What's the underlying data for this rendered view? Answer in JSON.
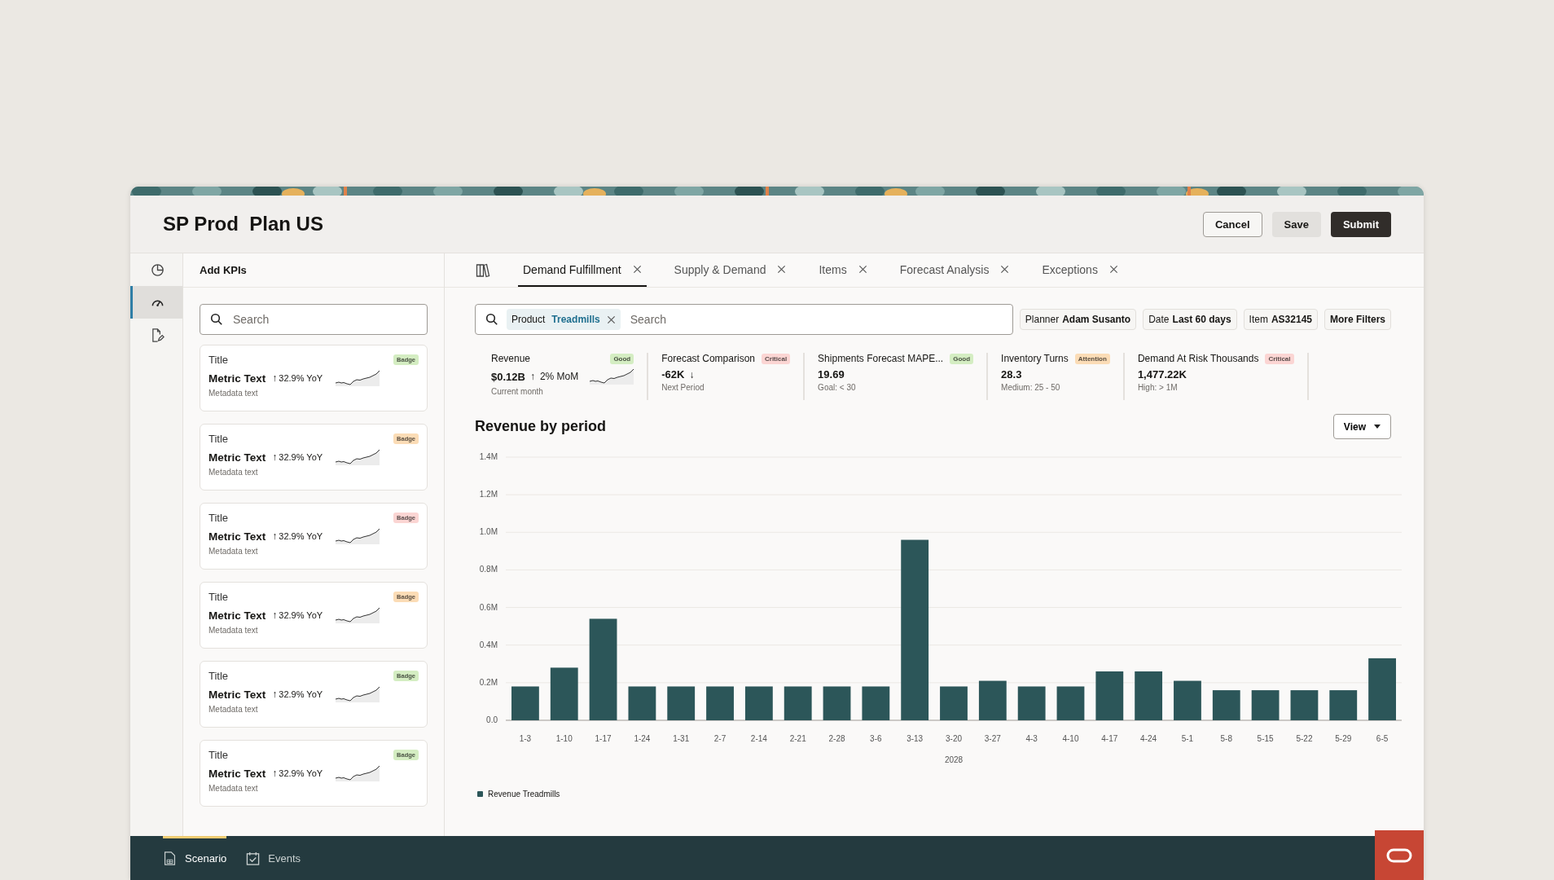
{
  "header": {
    "title": "SP Prod  Plan US",
    "buttons": [
      {
        "label": "Cancel",
        "kind": "outline"
      },
      {
        "label": "Save",
        "kind": "secondary"
      },
      {
        "label": "Submit",
        "kind": "primary"
      }
    ]
  },
  "rail": [
    {
      "selected": false
    },
    {
      "selected": true
    },
    {
      "selected": false
    }
  ],
  "kpi_panel": {
    "title": "Add KPIs",
    "search": {
      "placeholder": "Search"
    },
    "cards": [
      {
        "title": "Title",
        "metric": "Metric Text",
        "arrow": "↑",
        "change": "32.9% YoY",
        "meta": "Metadata text",
        "badge": "Badge",
        "color": "#d4edc2"
      },
      {
        "title": "Title",
        "metric": "Metric Text",
        "arrow": "↑",
        "change": "32.9% YoY",
        "meta": "Metadata text",
        "badge": "Badge",
        "color": "#fbdcb6"
      },
      {
        "title": "Title",
        "metric": "Metric Text",
        "arrow": "↑",
        "change": "32.9% YoY",
        "meta": "Metadata text",
        "badge": "Badge",
        "color": "#fbd5d3"
      },
      {
        "title": "Title",
        "metric": "Metric Text",
        "arrow": "↑",
        "change": "32.9% YoY",
        "meta": "Metadata text",
        "badge": "Badge",
        "color": "#fbdcb6"
      },
      {
        "title": "Title",
        "metric": "Metric Text",
        "arrow": "↑",
        "change": "32.9% YoY",
        "meta": "Metadata text",
        "badge": "Badge",
        "color": "#d4edc2"
      },
      {
        "title": "Title",
        "metric": "Metric Text",
        "arrow": "↑",
        "change": "32.9% YoY",
        "meta": "Metadata text",
        "badge": "Badge",
        "color": "#d4edc2"
      }
    ]
  },
  "tabs": [
    {
      "label": "Demand Fulfillment",
      "selected": true
    },
    {
      "label": "Supply & Demand",
      "selected": false
    },
    {
      "label": "Items",
      "selected": false
    },
    {
      "label": "Forecast Analysis",
      "selected": false
    },
    {
      "label": "Exceptions",
      "selected": false
    }
  ],
  "filter_bar": {
    "search_chip": {
      "label": "Product",
      "value": "Treadmills"
    },
    "search": {
      "placeholder": "Search"
    },
    "chips": [
      {
        "label": "Planner",
        "value": "Adam Susanto"
      },
      {
        "label": "Date",
        "value": "Last 60 days"
      },
      {
        "label": "Item",
        "value": "AS32145"
      }
    ],
    "more_button": "More Filters"
  },
  "kpis": [
    {
      "label": "Revenue",
      "badge": "Good",
      "color": "#d4edc2",
      "value": "$0.12B",
      "arrow": "↑",
      "change": "2% MoM",
      "sparkline": true,
      "meta": "Current month"
    },
    {
      "label": "Forecast Comparison",
      "badge": "Critical",
      "color": "#fbd5d3",
      "value": "-62K",
      "arrow": "↓",
      "sparkline": false,
      "meta": "Next Period"
    },
    {
      "label": "Shipments Forecast MAPE...",
      "badge": "Good",
      "color": "#d4edc2",
      "value": "19.69",
      "sparkline": false,
      "meta": "Goal: < 30"
    },
    {
      "label": "Inventory Turns",
      "badge": "Attention",
      "color": "#fbdcb6",
      "value": "28.3",
      "sparkline": false,
      "meta": "Medium: 25 - 50"
    },
    {
      "label": "Demand At Risk Thousands",
      "badge": "Critical",
      "color": "#fbd5d3",
      "value": "1,477.22K",
      "sparkline": false,
      "meta": "High: > 1M"
    }
  ],
  "chart_panel": {
    "view_button": "View",
    "chart_data": {
      "type": "bar",
      "title": "Revenue by period",
      "xlabel": "2028",
      "categories": [
        "1-3",
        "1-10",
        "1-17",
        "1-24",
        "1-31",
        "2-7",
        "2-14",
        "2-21",
        "2-28",
        "3-6",
        "3-13",
        "3-20",
        "3-27",
        "4-3",
        "4-10",
        "4-17",
        "4-24",
        "5-1",
        "5-8",
        "5-15",
        "5-22",
        "5-29",
        "6-5"
      ],
      "series": [
        {
          "name": "Revenue Treadmills",
          "color": "#2c5659",
          "values": [
            0.18,
            0.28,
            0.54,
            0.18,
            0.18,
            0.18,
            0.18,
            0.18,
            0.18,
            0.18,
            0.96,
            0.18,
            0.21,
            0.18,
            0.18,
            0.26,
            0.26,
            0.21,
            0.16,
            0.16,
            0.16,
            0.16,
            0.33
          ]
        }
      ],
      "ylim": [
        0,
        1.4
      ],
      "grid": true,
      "yticks": [
        {
          "value": 0,
          "label": "0.0"
        },
        {
          "value": 0.2,
          "label": "0.2M"
        },
        {
          "value": 0.4,
          "label": "0.4M"
        },
        {
          "value": 0.6,
          "label": "0.6M"
        },
        {
          "value": 0.8,
          "label": "0.8M"
        },
        {
          "value": 1.0,
          "label": "1.0M"
        },
        {
          "value": 1.2,
          "label": "1.2M"
        },
        {
          "value": 1.4,
          "label": "1.4M"
        }
      ]
    }
  },
  "bottom_tabs": [
    {
      "label": "Scenario",
      "selected": true
    },
    {
      "label": "Events",
      "selected": false
    }
  ]
}
